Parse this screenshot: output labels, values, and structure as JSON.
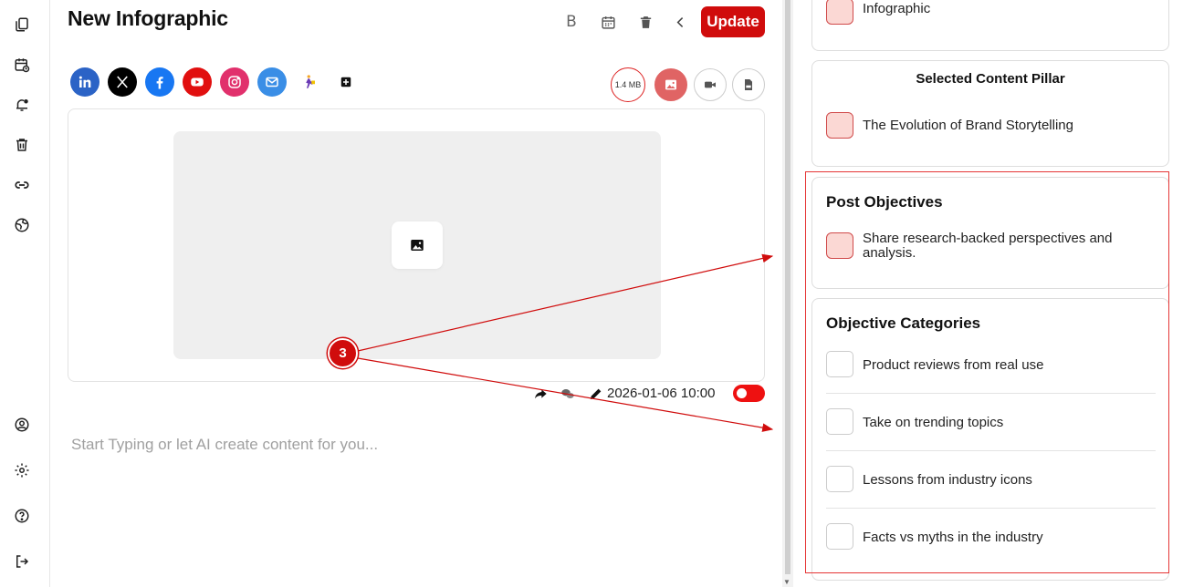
{
  "editor": {
    "title": "New Infographic",
    "bold_label": "B",
    "update_label": "Update",
    "file_size": "1.4 MB",
    "schedule": "2026-01-06 10:00",
    "compose_placeholder": "Start Typing or let AI create content for you..."
  },
  "social_channels": [
    "linkedin-icon",
    "x-icon",
    "facebook-icon",
    "youtube-icon",
    "instagram-icon",
    "email-icon",
    "custom-channel-icon"
  ],
  "sidebar_icons": [
    "pages-icon",
    "calendar-icon",
    "notifications-icon",
    "trash-icon",
    "link-icon",
    "globe-icon",
    "profile-icon",
    "settings-icon",
    "help-icon",
    "logout-icon"
  ],
  "right_panel": {
    "content_type_partial": "Infographic",
    "pillar": {
      "title": "Selected Content Pillar",
      "item": "The Evolution of Brand Storytelling"
    },
    "post_objectives": {
      "title": "Post Objectives",
      "item": "Share research-backed perspectives and analysis."
    },
    "objective_categories": {
      "title": "Objective Categories",
      "items": [
        "Product reviews from real use",
        "Take on trending topics",
        "Lessons from industry icons",
        "Facts vs myths in the industry"
      ]
    }
  },
  "annotation": {
    "marker_number": "3"
  },
  "colors": {
    "accent": "#d00c0c",
    "swatch_fill": "#fbd8d4",
    "highlight": "#e53535"
  }
}
